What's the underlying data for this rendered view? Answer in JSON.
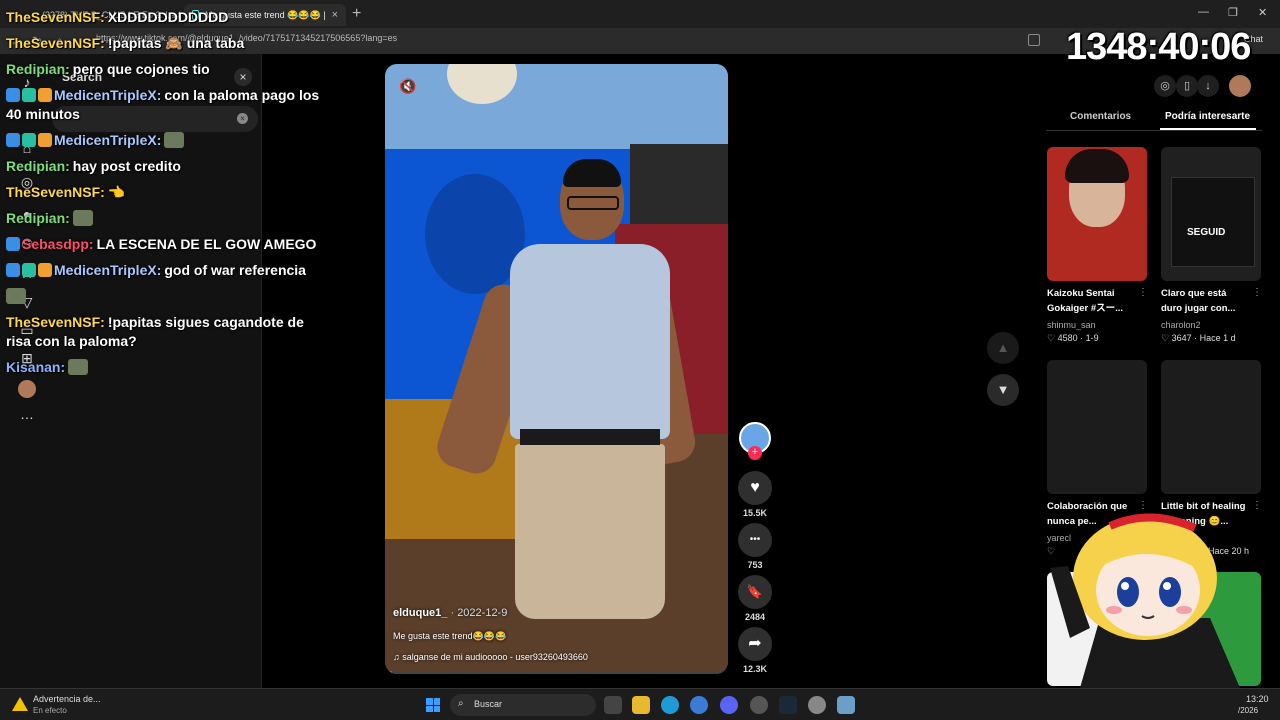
{
  "browser": {
    "tabs": [
      {
        "label": "(3278) THE P_CLUB LE Ep 2: La S",
        "close": "×"
      },
      {
        "label": "Me gusta este trend 😂😂😂 |",
        "close": "×"
      }
    ],
    "new_tab": "+",
    "url": "https://www.tiktok.com/@elduque1_/video/7175171345217506565?lang=es",
    "chat_label": "Chat",
    "window_controls": [
      "—",
      "❐",
      "✕"
    ]
  },
  "sidebar": {
    "search_label": "Search",
    "search_clear": "×",
    "close": "×"
  },
  "chat": [
    {
      "user": "TheSevenNSF:",
      "user_color": "#ffd84d",
      "text": "XDDDDDDDDDDD",
      "badges": 0
    },
    {
      "user": "TheSevenNSF:",
      "user_color": "#ffd84d",
      "text": "!papitas 🙈 una taba",
      "badges": 0
    },
    {
      "user": "Redipian:",
      "user_color": "#7be07b",
      "text": "pero que cojones tio",
      "badges": 0
    },
    {
      "user": "MedicenTripleX:",
      "user_color": "#a8c8ff",
      "text": "con la paloma pago los 40 minutos",
      "badges": 3
    },
    {
      "user": "MedicenTripleX:",
      "user_color": "#a8c8ff",
      "text": "",
      "badges": 3,
      "emote": true
    },
    {
      "user": "Redipian:",
      "user_color": "#7be07b",
      "text": "hay post credito",
      "badges": 0
    },
    {
      "user": "TheSevenNSF:",
      "user_color": "#ffd84d",
      "text": "👈",
      "badges": 0
    },
    {
      "user": "Redipian:",
      "user_color": "#7be07b",
      "text": "",
      "badges": 0,
      "emote": true
    },
    {
      "user": "Sebasdpp:",
      "user_color": "#ff4d6a",
      "text": "LA ESCENA DE EL GOW AMEGO",
      "badges": 1
    },
    {
      "user": "MedicenTripleX:",
      "user_color": "#a8c8ff",
      "text": "god of war referencia",
      "badges": 3
    },
    {
      "user": "",
      "user_color": "#fff",
      "text": "",
      "badges": 0,
      "emote": true
    },
    {
      "user": "TheSevenNSF:",
      "user_color": "#ffd84d",
      "text": "!papitas sigues cagandote de risa con la paloma?",
      "badges": 0
    },
    {
      "user": "Kisanan:",
      "user_color": "#8ab4ff",
      "text": "",
      "badges": 0,
      "emote": true
    }
  ],
  "timer": "1348:40:06",
  "video": {
    "author": "elduque1_",
    "date": "· 2022-12-9",
    "caption": "Me gusta este trend😂😂😂",
    "music": "♫  salganse de mi audiooooo - user93260493660",
    "progress": 0.02,
    "mute_icon": "🔇"
  },
  "actions": {
    "like_count": "15.5K",
    "comment_count": "753",
    "bookmark_count": "2484",
    "share_count": "12.3K",
    "icons": {
      "like": "♥",
      "comment": "•••",
      "bookmark": "🔖",
      "share": "➦",
      "follow": "+",
      "up": "▲",
      "down": "▼"
    }
  },
  "right_panel": {
    "tabs": [
      "Comentarios",
      "Podría interesarte"
    ],
    "cards": [
      {
        "title": "Kaizoku Sentai\nGokaiger #スー...",
        "author": "shinmu_san",
        "meta": "♡ 4580 · 1-9",
        "thumb_text": ""
      },
      {
        "title": "Claro que está\nduro jugar con...",
        "author": "charolon2",
        "meta": "♡ 3647 · Hace 1 d",
        "thumb_text": "SEGUID"
      },
      {
        "title": "Colaboración que\nnunca pe...",
        "author": "yarecl",
        "meta": "♡",
        "thumb_text": ""
      },
      {
        "title": "Little bit of healing\n...ppening 😊...",
        "author": "",
        "meta": "Hace 20 h",
        "thumb_text": ""
      }
    ],
    "dots": "⋮"
  },
  "taskbar": {
    "warning_title": "Advertencia de...",
    "warning_sub": "En efecto",
    "search_text": "Buscar",
    "search_icon": "⌕",
    "time": "13:20",
    "date": "/2026"
  }
}
